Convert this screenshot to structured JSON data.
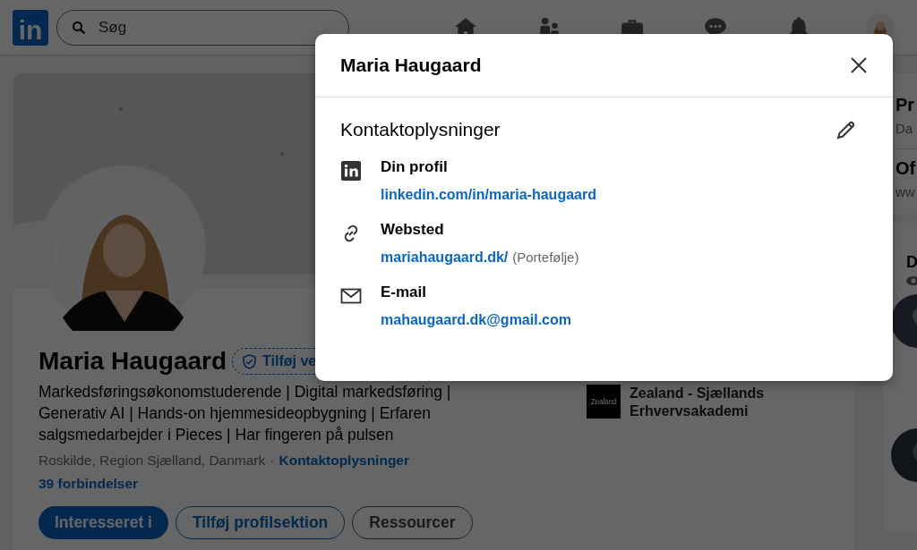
{
  "nav": {
    "logo": "in",
    "search": {
      "placeholder": "Søg"
    }
  },
  "profile": {
    "name": "Maria Haugaard",
    "verify_badge": "Tilføj ve",
    "headline": "Markedsføringsøkonomstuderende | Digital markedsføring | Generativ AI | Hands-on hjemmesideopbygning | Erfaren salgsmedarbejder i Pieces | Har fingeren på pulsen",
    "location": "Roskilde, Region Sjælland, Danmark",
    "separator": "·",
    "contact_link": "Kontaktoplysninger",
    "connections": "39 forbindelser",
    "buttons": [
      {
        "label": "Interesseret i",
        "kind": "primary"
      },
      {
        "label": "Tilføj profilsektion",
        "kind": "secondary"
      },
      {
        "label": "Ressourcer",
        "kind": "neutral"
      }
    ],
    "education": {
      "logo_text": "Zealand",
      "name": "Zealand - Sjællands Erhvervsakademi"
    }
  },
  "right_column": [
    {
      "title": "Pr",
      "subtitle": "Da"
    },
    {
      "title": "Of",
      "subtitle": "ww"
    },
    {
      "title": "D"
    }
  ],
  "modal": {
    "title": "Maria Haugaard",
    "section_title": "Kontaktoplysninger",
    "items": [
      {
        "kind": "linkedin",
        "label": "Din profil",
        "link": "linkedin.com/in/maria-haugaard"
      },
      {
        "kind": "website",
        "label": "Websted",
        "link": "mariahaugaard.dk/",
        "note": "(Portefølje)"
      },
      {
        "kind": "email",
        "label": "E-mail",
        "link": "mahaugaard.dk@gmail.com"
      }
    ]
  }
}
